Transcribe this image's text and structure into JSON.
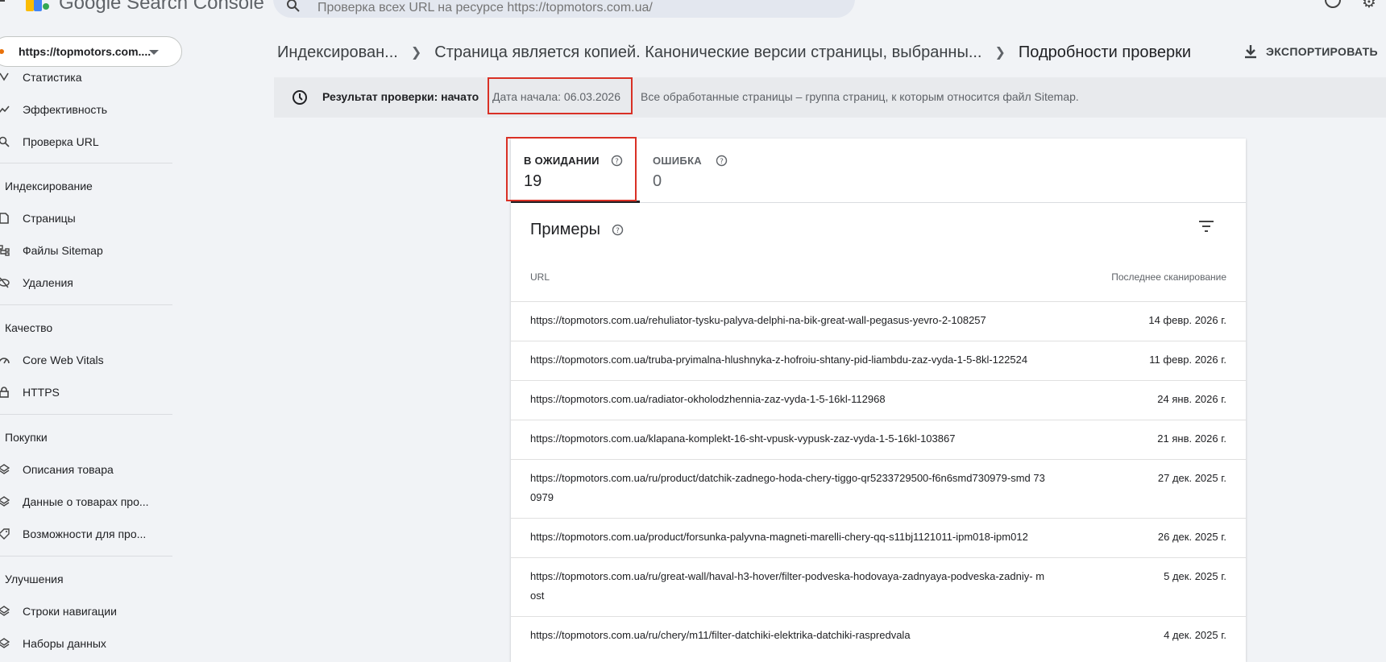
{
  "header": {
    "brand": "Google Search Console",
    "search_placeholder": "Проверка всех URL на ресурсе https://topmotors.com.ua/"
  },
  "sidebar": {
    "property": "https://topmotors.com....",
    "items_top": [
      {
        "label": "Статистика",
        "icon": "stats-icon"
      },
      {
        "label": "Эффективность",
        "icon": "trending-icon"
      },
      {
        "label": "Проверка URL",
        "icon": "search-icon"
      }
    ],
    "sections": [
      {
        "title": "Индексирование",
        "items": [
          {
            "label": "Страницы",
            "icon": "page-icon"
          },
          {
            "label": "Файлы Sitemap",
            "icon": "sitemap-icon"
          },
          {
            "label": "Удаления",
            "icon": "eye-off-icon"
          }
        ]
      },
      {
        "title": "Качество",
        "items": [
          {
            "label": "Core Web Vitals",
            "icon": "gauge-icon"
          },
          {
            "label": "HTTPS",
            "icon": "lock-icon"
          }
        ]
      },
      {
        "title": "Покупки",
        "items": [
          {
            "label": "Описания товара",
            "icon": "layers-icon"
          },
          {
            "label": "Данные о товарах про...",
            "icon": "layers-icon"
          },
          {
            "label": "Возможности для про...",
            "icon": "tag-icon"
          }
        ]
      },
      {
        "title": "Улучшения",
        "items": [
          {
            "label": "Строки навигации",
            "icon": "layers-icon"
          },
          {
            "label": "Наборы данных",
            "icon": "layers-icon"
          }
        ]
      }
    ]
  },
  "breadcrumb": {
    "items": [
      "Индексирован...",
      "Страница является копией. Канонические версии страницы, выбранны...",
      "Подробности проверки"
    ]
  },
  "export_label": "ЭКСПОРТИРОВАТЬ",
  "result": {
    "title": "Результат проверки: начато",
    "date": "Дата начала: 06.03.2026",
    "description": "Все обработанные страницы – группа страниц, к которым относится файл Sitemap."
  },
  "tabs": [
    {
      "label": "В ОЖИДАНИИ",
      "count": "19"
    },
    {
      "label": "ОШИБКА",
      "count": "0"
    }
  ],
  "examples": {
    "title": "Примеры",
    "col_url": "URL",
    "col_date": "Последнее сканирование",
    "rows": [
      {
        "url": "https://topmotors.com.ua/rehuliator-tysku-palyva-delphi-na-bik-great-wall-pegasus-yevro-2-108257",
        "date": "14 февр. 2026 г."
      },
      {
        "url": "https://topmotors.com.ua/truba-pryimalna-hlushnyka-z-hofroiu-shtany-pid-liambdu-zaz-vyda-1-5-8kl-122524",
        "date": "11 февр. 2026 г."
      },
      {
        "url": "https://topmotors.com.ua/radiator-okholodzhennia-zaz-vyda-1-5-16kl-112968",
        "date": "24 янв. 2026 г."
      },
      {
        "url": "https://topmotors.com.ua/klapana-komplekt-16-sht-vpusk-vypusk-zaz-vyda-1-5-16kl-103867",
        "date": "21 янв. 2026 г."
      },
      {
        "url": "https://topmotors.com.ua/ru/product/datchik-zadnego-hoda-chery-tiggo-qr5233729500-f6n6smd730979-smd 730979",
        "date": "27 дек. 2025 г."
      },
      {
        "url": "https://topmotors.com.ua/product/forsunka-palyvna-magneti-marelli-chery-qq-s11bj1121011-ipm018-ipm012",
        "date": "26 дек. 2025 г."
      },
      {
        "url": "https://topmotors.com.ua/ru/great-wall/haval-h3-hover/filter-podveska-hodovaya-zadnyaya-podveska-zadniy- most",
        "date": "5 дек. 2025 г."
      },
      {
        "url": "https://topmotors.com.ua/ru/chery/m11/filter-datchiki-elektrika-datchiki-raspredvala",
        "date": "4 дек. 2025 г."
      }
    ]
  },
  "colors": {
    "highlight": "#d93025",
    "accent": "#202124"
  }
}
